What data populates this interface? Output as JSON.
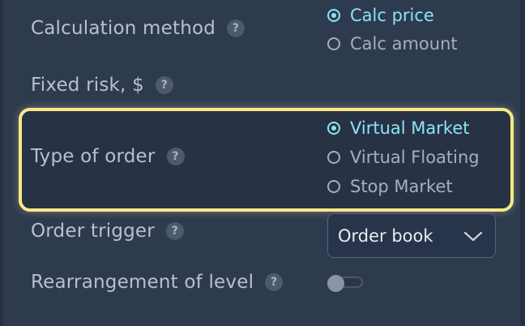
{
  "settings": {
    "calc_method": {
      "label": "Calculation method",
      "help": "?",
      "options": [
        {
          "label": "Calc price",
          "selected": true
        },
        {
          "label": "Calc amount",
          "selected": false
        }
      ]
    },
    "fixed_risk": {
      "label": "Fixed risk, $",
      "help": "?"
    },
    "type_of_order": {
      "label": "Type of order",
      "help": "?",
      "options": [
        {
          "label": "Virtual Market",
          "selected": true
        },
        {
          "label": "Virtual Floating",
          "selected": false
        },
        {
          "label": "Stop Market",
          "selected": false
        }
      ]
    },
    "order_trigger": {
      "label": "Order trigger",
      "help": "?",
      "value": "Order book"
    },
    "rearrangement": {
      "label": "Rearrangement of level",
      "help": "?",
      "enabled": false
    }
  },
  "colors": {
    "background": "#2e3b4f",
    "accent": "#8be4f4",
    "highlight": "#f6e889",
    "label": "#b7c0cd"
  },
  "icons": {
    "help": "question-circle-icon",
    "dropdown": "chevron-down-icon"
  }
}
